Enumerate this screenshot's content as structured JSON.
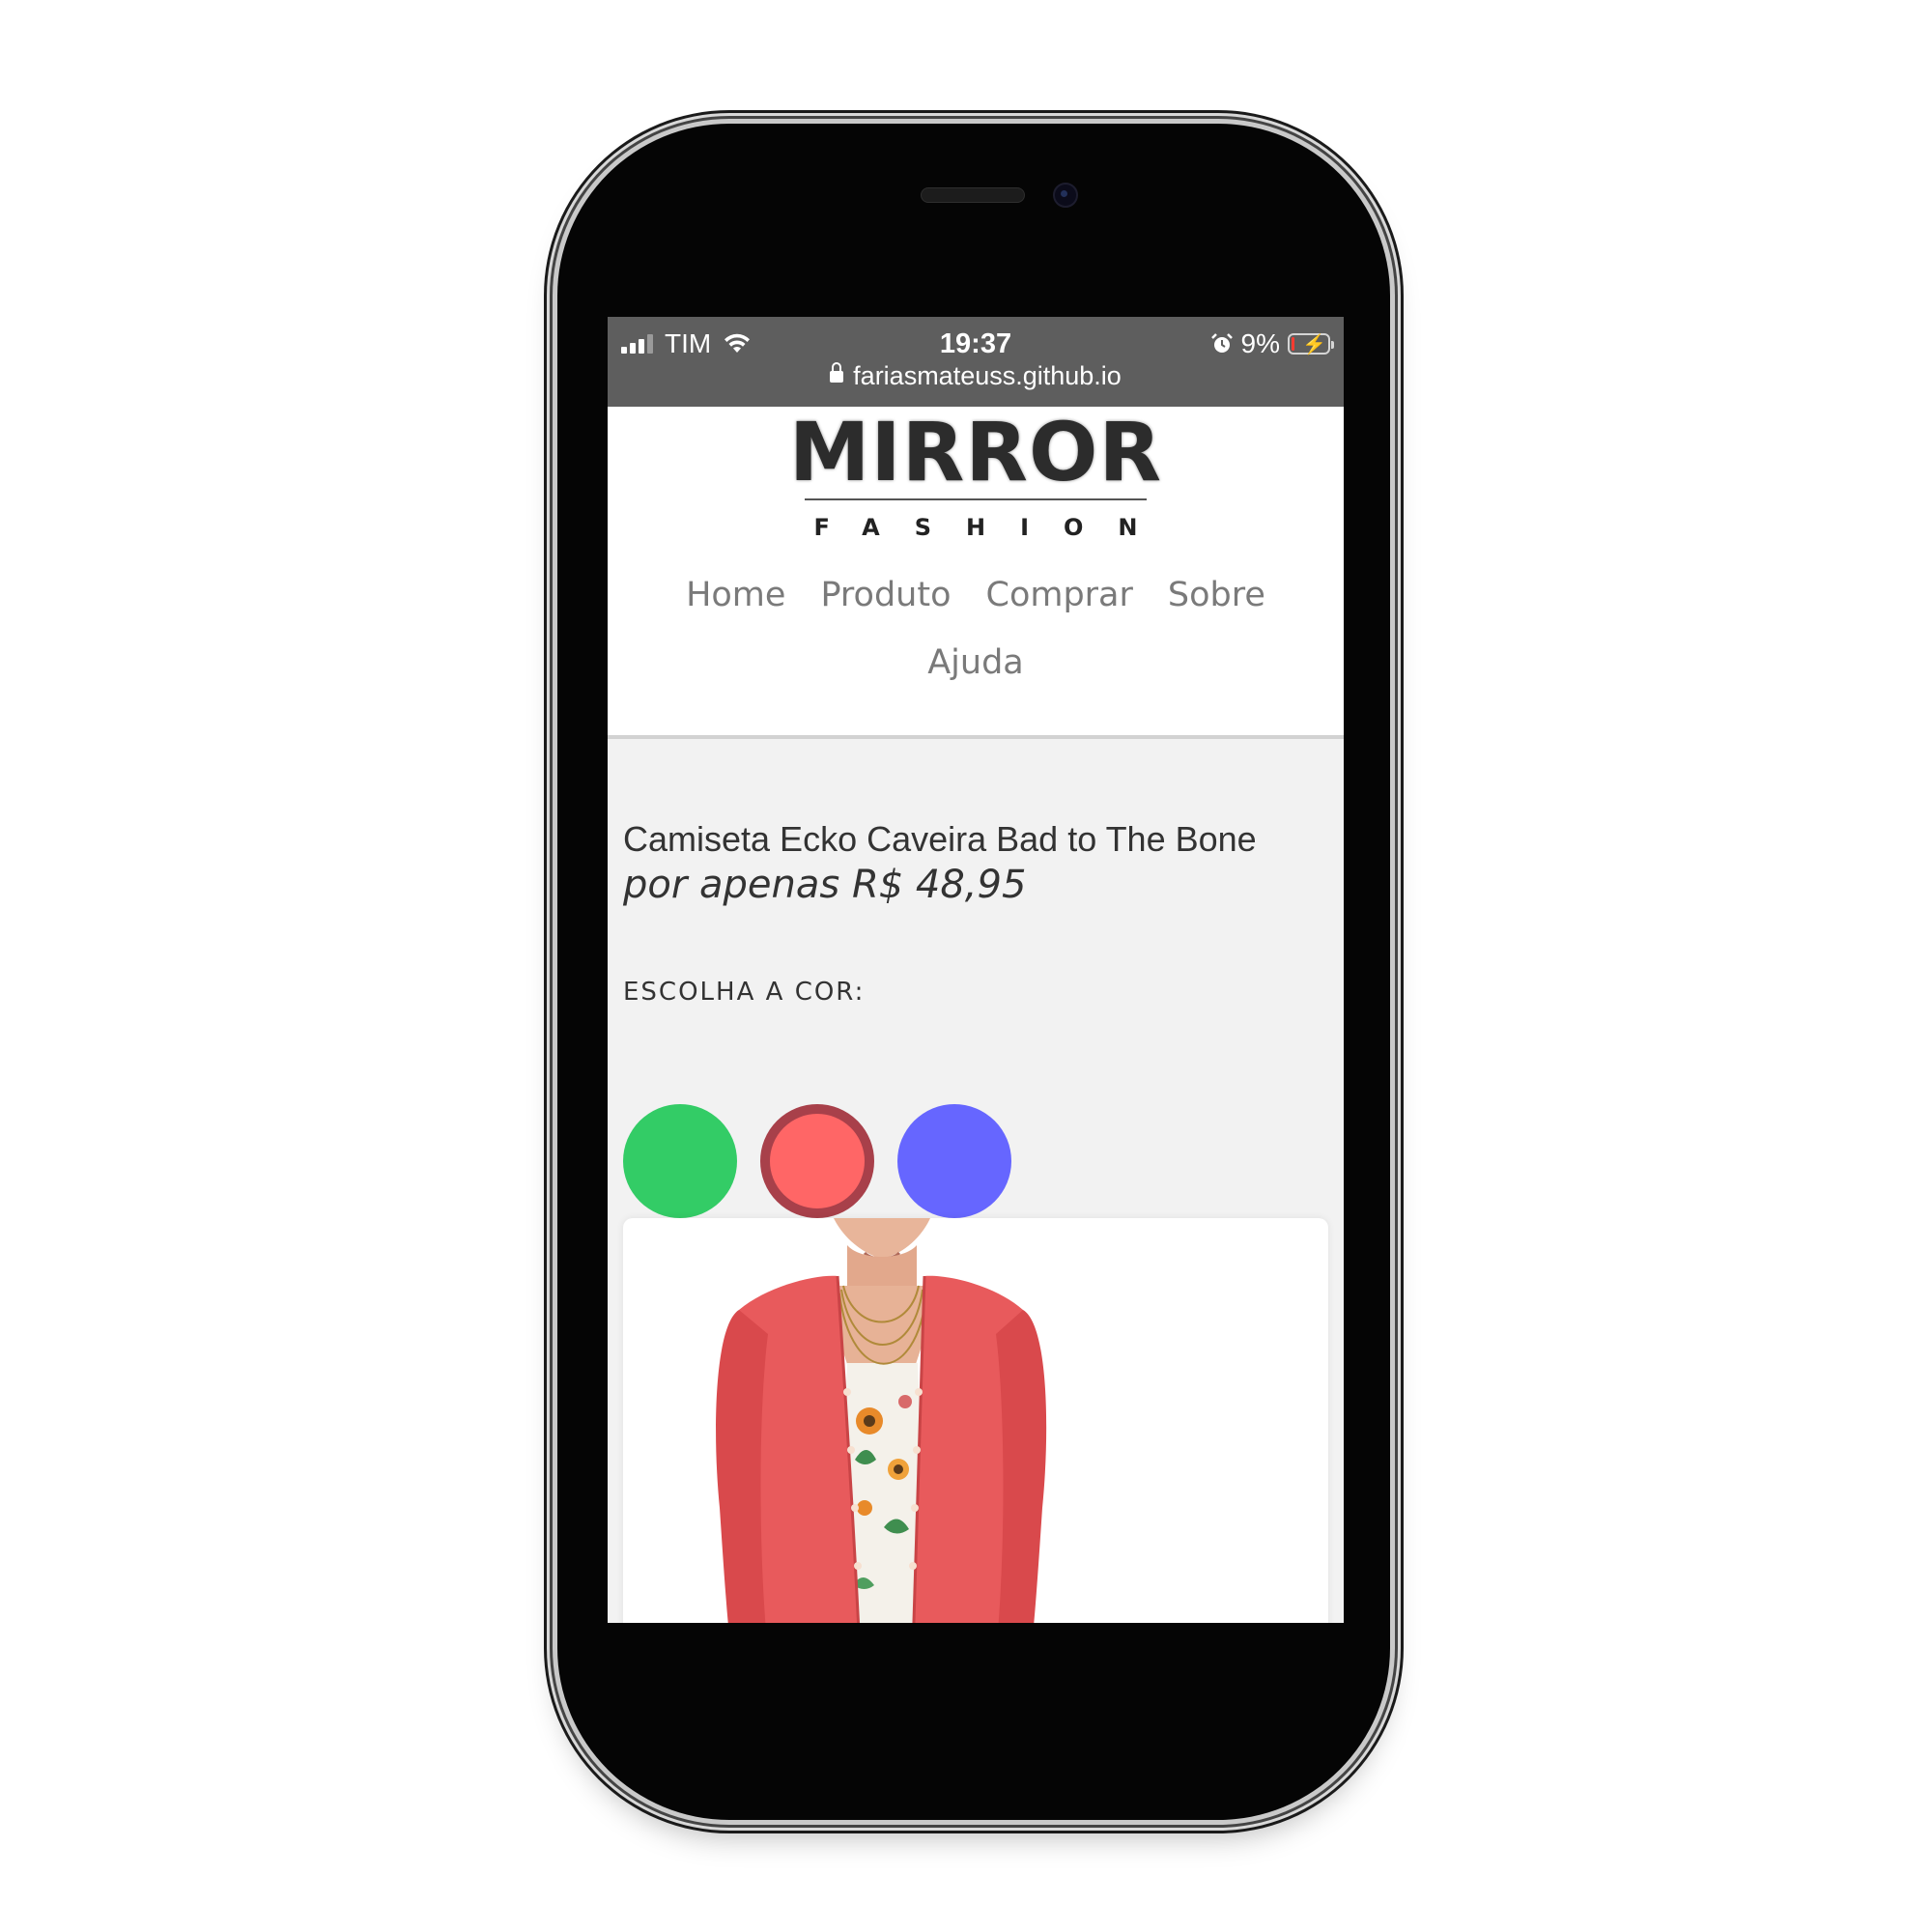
{
  "status_bar": {
    "carrier": "TIM",
    "time": "19:37",
    "battery_percent": "9%",
    "battery_level": 0.09,
    "alarm_icon": "alarm-icon",
    "wifi_icon": "wifi-icon",
    "url": "fariasmateuss.github.io"
  },
  "header": {
    "logo_main": "MIRRΟR",
    "logo_sub": "FASHION",
    "nav": [
      "Home",
      "Produto",
      "Comprar",
      "Sobre",
      "Ajuda"
    ]
  },
  "product": {
    "title": "Camiseta Ecko Caveira Bad to The Bone",
    "price": "por apenas R$ 48,95",
    "choose_color_label": "ESCOLHA A COR:",
    "colors": [
      {
        "name": "green",
        "hex": "#33cc66",
        "selected": false
      },
      {
        "name": "red",
        "hex": "#ff6666",
        "selected": true
      },
      {
        "name": "blue",
        "hex": "#6666ff",
        "selected": false
      }
    ]
  },
  "colors": {
    "statusbar_bg": "#5e5e5e",
    "page_bg": "#f2f2f2",
    "cardigan": "#e85a5c"
  }
}
